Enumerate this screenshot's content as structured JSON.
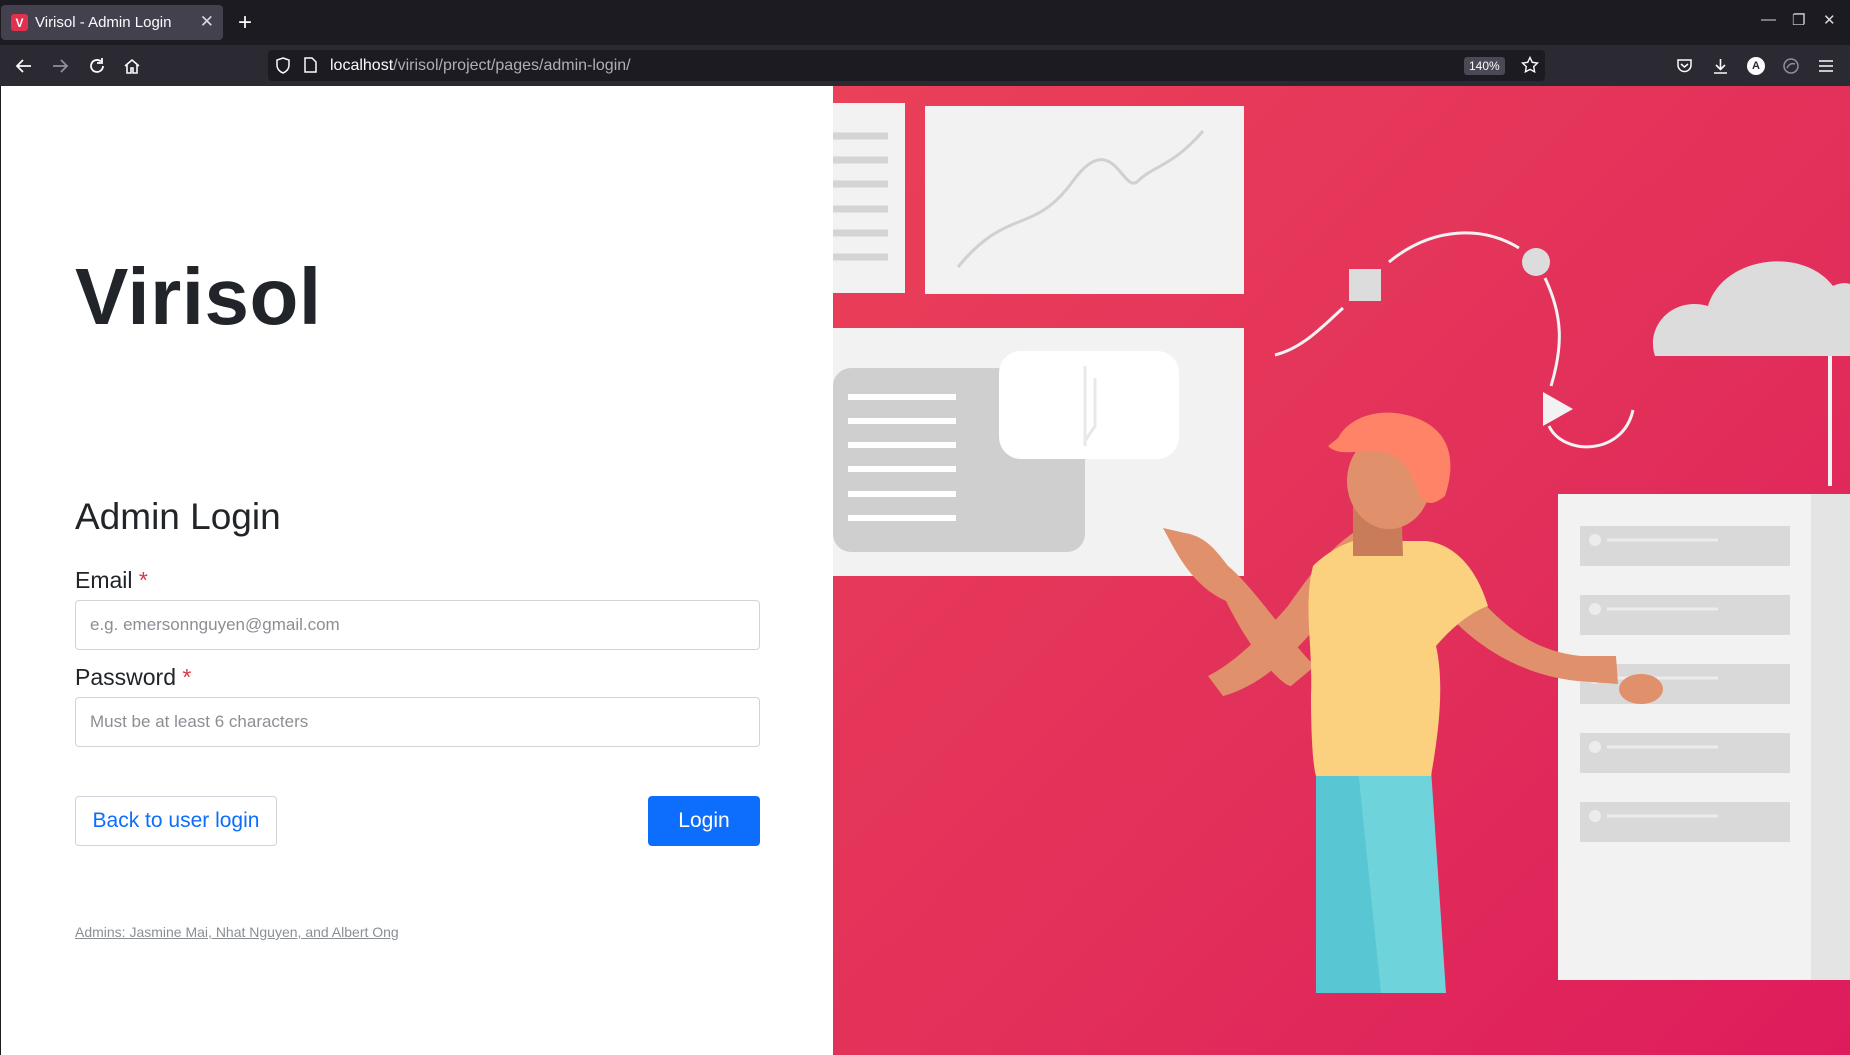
{
  "browser": {
    "tab_title": "Virisol - Admin Login",
    "favicon_letter": "V",
    "url_host": "localhost",
    "url_path": "/virisol/project/pages/admin-login/",
    "zoom": "140%",
    "profile_letter": "A"
  },
  "page": {
    "brand": "Virisol",
    "form_title": "Admin Login",
    "email_label": "Email",
    "email_placeholder": "e.g. emersonnguyen@gmail.com",
    "password_label": "Password",
    "password_placeholder": "Must be at least 6 characters",
    "required_mark": "*",
    "back_button": "Back to user login",
    "login_button": "Login",
    "admins_note": "Admins: Jasmine Mai, Nhat Nguyen, and Albert Ong"
  },
  "colors": {
    "accent": "#0d6efd",
    "hero_background": "#e2305a",
    "required": "#dc3545"
  },
  "icons": [
    "back-icon",
    "forward-icon",
    "reload-icon",
    "home-icon",
    "shield-icon",
    "page-icon",
    "star-icon",
    "pocket-icon",
    "download-icon",
    "account-icon",
    "extension-icon",
    "menu-icon"
  ]
}
